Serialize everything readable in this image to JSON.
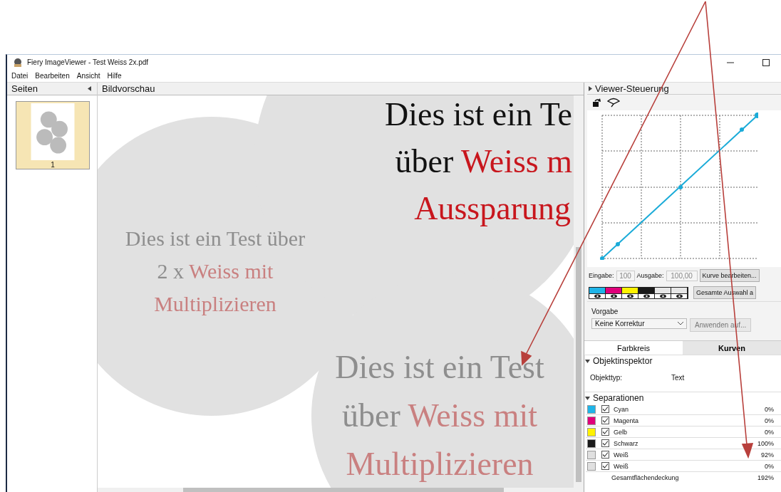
{
  "window": {
    "title": "Fiery ImageViewer - Test Weiss 2x.pdf"
  },
  "menu": [
    "Datei",
    "Bearbeiten",
    "Ansicht",
    "Hilfe"
  ],
  "pages_panel": {
    "title": "Seiten",
    "pages": [
      {
        "label": "1",
        "selected": true
      }
    ]
  },
  "preview": {
    "title": "Bildvorschau",
    "blocks": [
      {
        "faded": false,
        "lines": [
          [
            {
              "text": "Dies ist ein Te",
              "accent": false
            }
          ],
          [
            {
              "text": "über ",
              "accent": false
            },
            {
              "text": "Weiss m",
              "accent": true
            }
          ],
          [
            {
              "text": "Aussparung",
              "accent": true
            }
          ]
        ]
      },
      {
        "faded": true,
        "lines": [
          [
            {
              "text": "Dies ist ein Test über",
              "accent": false
            }
          ],
          [
            {
              "text": "2 x ",
              "accent": false
            },
            {
              "text": "Weiss mit",
              "accent": true
            }
          ],
          [
            {
              "text": "Multiplizieren",
              "accent": true
            }
          ]
        ]
      },
      {
        "faded": true,
        "lines": [
          [
            {
              "text": "Dies ist ein Test",
              "accent": false
            }
          ],
          [
            {
              "text": "über ",
              "accent": false
            },
            {
              "text": "Weiss mit",
              "accent": true
            }
          ],
          [
            {
              "text": "Multiplizieren",
              "accent": true
            }
          ]
        ]
      }
    ]
  },
  "controls": {
    "title": "Viewer-Steuerung",
    "input_label": "Eingabe:",
    "input_value": "100",
    "output_label": "Ausgabe:",
    "output_value": "100,00",
    "edit_curve_button": "Kurve bearbeiten...",
    "channels": [
      {
        "color": "#1fb4e8"
      },
      {
        "color": "#e0007a"
      },
      {
        "color": "#fff200"
      },
      {
        "color": "#1a1a1a"
      },
      {
        "color": "#e6e6e6"
      },
      {
        "color": "#e6e6e6"
      }
    ],
    "select_all_button": "Gesamte Auswahl a",
    "preset_label": "Vorgabe",
    "preset_value": "Keine Korrektur",
    "apply_button": {
      "label": "Anwenden auf...",
      "disabled": true
    },
    "tabs": [
      {
        "label": "Farbkreis",
        "selected": false
      },
      {
        "label": "Kurven",
        "selected": true
      }
    ]
  },
  "inspector": {
    "title": "Objektinspektor",
    "object_type_label": "Objekttyp:",
    "object_type_value": "Text"
  },
  "separations": {
    "title": "Separationen",
    "rows": [
      {
        "color": "#1fb4e8",
        "checked": true,
        "name": "Cyan",
        "value": "0%"
      },
      {
        "color": "#e0007a",
        "checked": true,
        "name": "Magenta",
        "value": "0%"
      },
      {
        "color": "#fff200",
        "checked": true,
        "name": "Gelb",
        "value": "0%"
      },
      {
        "color": "#1a1a1a",
        "checked": true,
        "name": "Schwarz",
        "value": "100%"
      },
      {
        "color": "#e0e0e0",
        "checked": true,
        "name": "Weiß",
        "value": "92%"
      },
      {
        "color": "#e0e0e0",
        "checked": true,
        "name": "Weiß",
        "value": "0%"
      }
    ],
    "total_label": "Gesamtflächendeckung",
    "total_value": "192%"
  }
}
